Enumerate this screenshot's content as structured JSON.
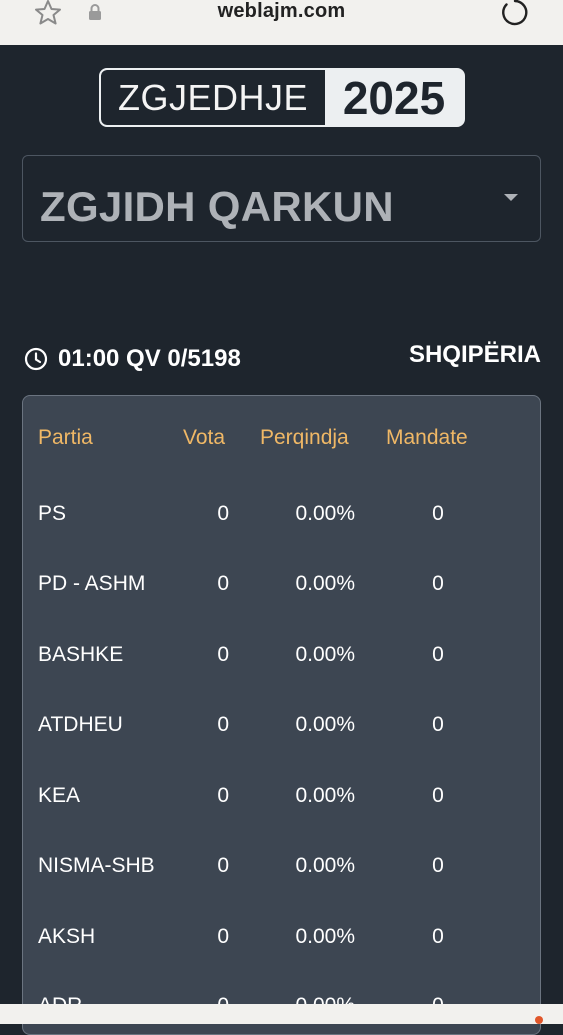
{
  "browser": {
    "url": "weblajm.com",
    "icons": [
      "star-icon",
      "lock-icon",
      "reload-icon"
    ],
    "indicator_color": "#e0562a"
  },
  "header": {
    "logo_word": "ZGJEDHJE",
    "logo_year": "2025"
  },
  "region_select": {
    "value": "ZGJIDH QARKUN"
  },
  "status": {
    "time": "01:00 QV 0/5198",
    "region": "SHQIPËRIA"
  },
  "results": {
    "headers": {
      "party": "Partia",
      "votes": "Vota",
      "percent": "Perqindja",
      "seats": "Mandate"
    },
    "rows": [
      {
        "party": "PS",
        "votes": "0",
        "percent": "0.00%",
        "seats": "0"
      },
      {
        "party": "PD - ASHM",
        "votes": "0",
        "percent": "0.00%",
        "seats": "0"
      },
      {
        "party": "BASHKE",
        "votes": "0",
        "percent": "0.00%",
        "seats": "0"
      },
      {
        "party": "ATDHEU",
        "votes": "0",
        "percent": "0.00%",
        "seats": "0"
      },
      {
        "party": "KEA",
        "votes": "0",
        "percent": "0.00%",
        "seats": "0"
      },
      {
        "party": "NISMA-SHB",
        "votes": "0",
        "percent": "0.00%",
        "seats": "0"
      },
      {
        "party": "AKSH",
        "votes": "0",
        "percent": "0.00%",
        "seats": "0"
      },
      {
        "party": "ADR",
        "votes": "0",
        "percent": "0.00%",
        "seats": "0"
      }
    ]
  },
  "colors": {
    "background": "#1e252d",
    "card": "#3d4652",
    "header_accent": "#f0b866"
  }
}
